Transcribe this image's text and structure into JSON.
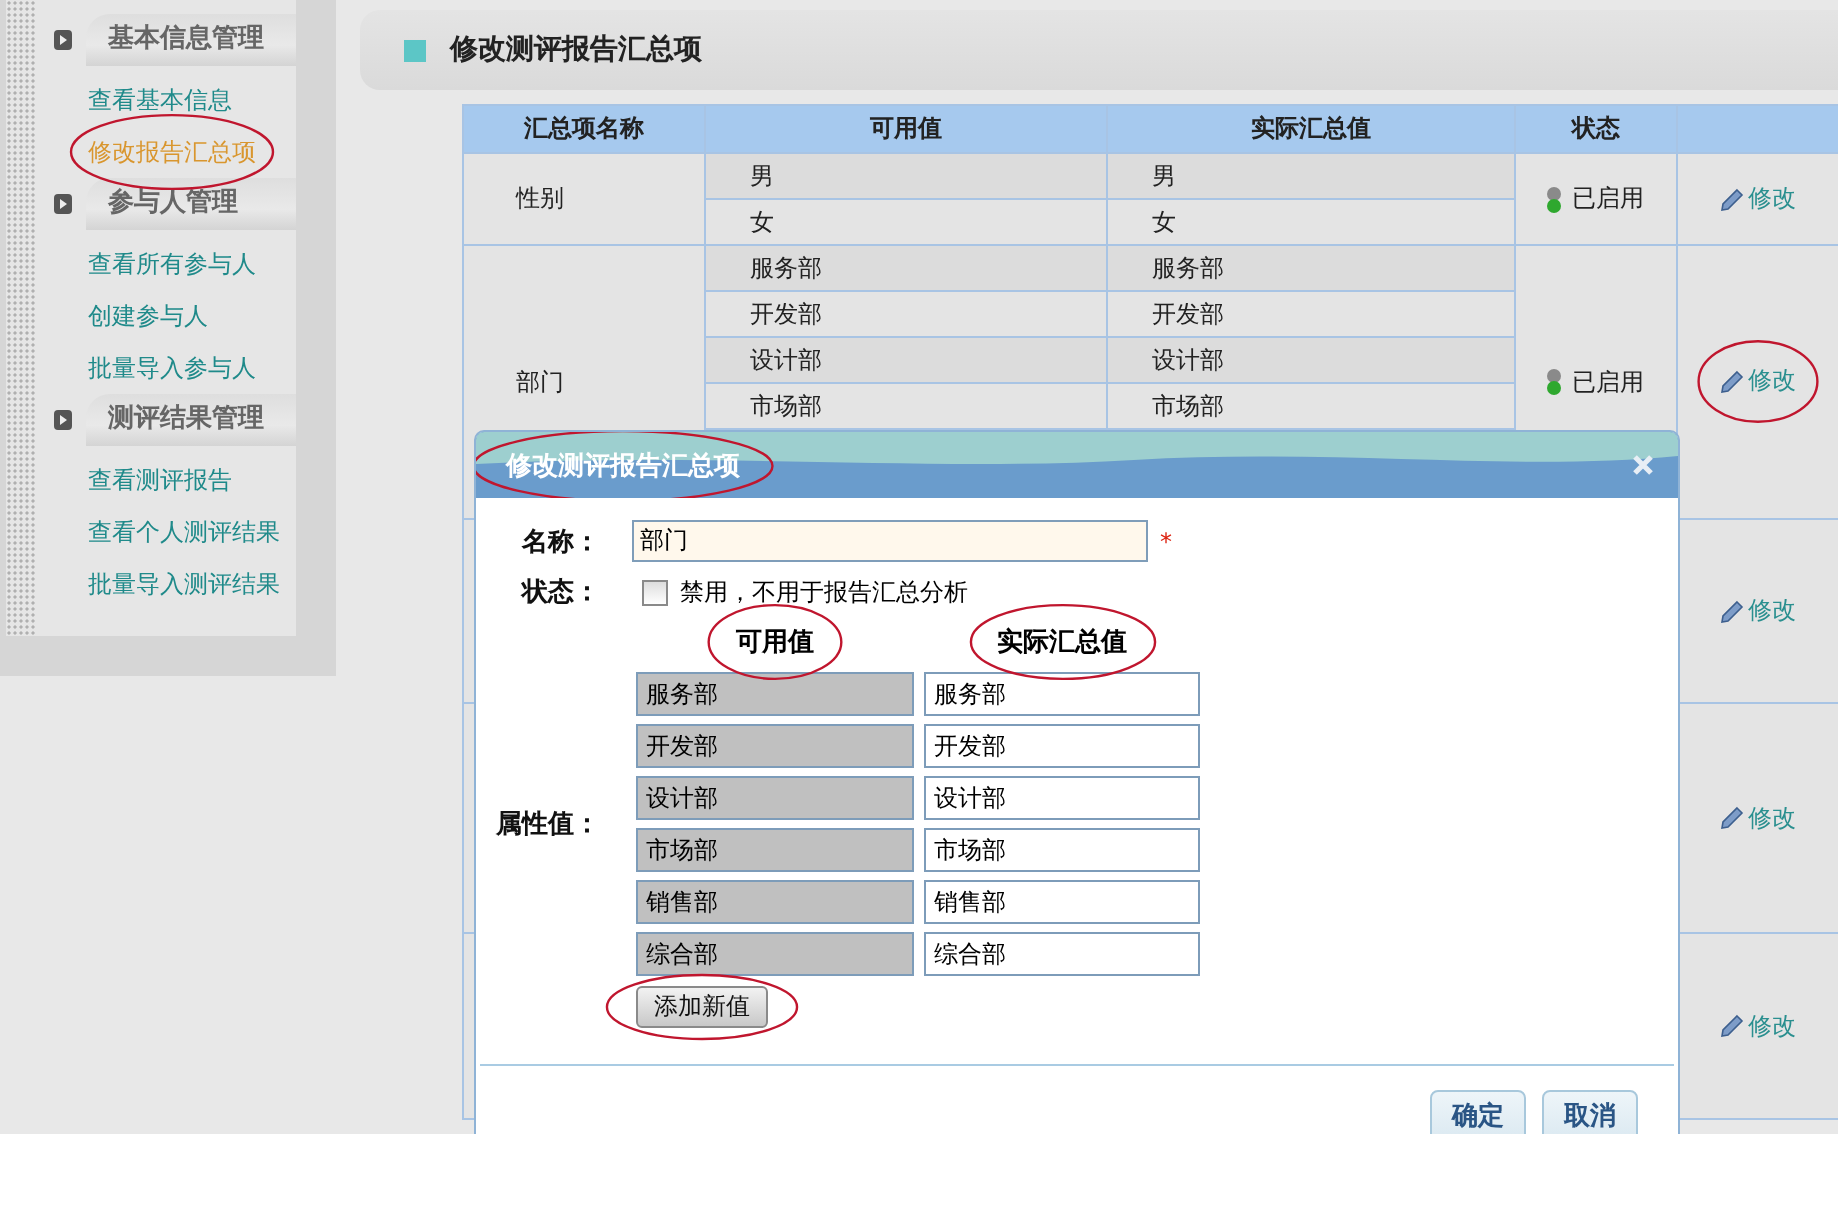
{
  "sidebar": {
    "sections": [
      {
        "title": "基本信息管理",
        "items": [
          {
            "label": "查看基本信息",
            "selected": false,
            "circled": false
          },
          {
            "label": "修改报告汇总项",
            "selected": true,
            "circled": true
          }
        ]
      },
      {
        "title": "参与人管理",
        "items": [
          {
            "label": "查看所有参与人",
            "selected": false,
            "circled": false
          },
          {
            "label": "创建参与人",
            "selected": false,
            "circled": false
          },
          {
            "label": "批量导入参与人",
            "selected": false,
            "circled": false
          }
        ]
      },
      {
        "title": "测评结果管理",
        "items": [
          {
            "label": "查看测评报告",
            "selected": false,
            "circled": false
          },
          {
            "label": "查看个人测评结果",
            "selected": false,
            "circled": false
          },
          {
            "label": "批量导入测评结果",
            "selected": false,
            "circled": false
          }
        ]
      }
    ]
  },
  "page_title": "修改测评报告汇总项",
  "table": {
    "columns": [
      "汇总项名称",
      "可用值",
      "实际汇总值",
      "状态"
    ],
    "rows": [
      {
        "name": "性别",
        "values": [
          {
            "available": "男",
            "actual": "男"
          },
          {
            "available": "女",
            "actual": "女"
          }
        ],
        "status": "已启用",
        "enabled": true,
        "action": "修改",
        "circled": false
      },
      {
        "name": "部门",
        "values": [
          {
            "available": "服务部",
            "actual": "服务部"
          },
          {
            "available": "开发部",
            "actual": "开发部"
          },
          {
            "available": "设计部",
            "actual": "设计部"
          },
          {
            "available": "市场部",
            "actual": "市场部"
          }
        ],
        "status": "已启用",
        "enabled": true,
        "action": "修改",
        "circled": true
      },
      {
        "action": "修改",
        "circled": false
      },
      {
        "action": "修改",
        "circled": false
      },
      {
        "action": "修改",
        "circled": false
      }
    ]
  },
  "dialog": {
    "title": "修改测评报告汇总项",
    "title_circled": true,
    "name_label": "名称：",
    "name_value": "部门",
    "required_mark": "*",
    "status_label": "状态：",
    "disable_checkbox": {
      "label": "禁用，不用于报告汇总分析",
      "checked": false
    },
    "columns": [
      {
        "label": "可用值",
        "circled": true
      },
      {
        "label": "实际汇总值",
        "circled": true
      }
    ],
    "values_label": "属性值：",
    "values": [
      {
        "available": "服务部",
        "actual": "服务部"
      },
      {
        "available": "开发部",
        "actual": "开发部"
      },
      {
        "available": "设计部",
        "actual": "设计部"
      },
      {
        "available": "市场部",
        "actual": "市场部"
      },
      {
        "available": "销售部",
        "actual": "销售部"
      },
      {
        "available": "综合部",
        "actual": "综合部"
      }
    ],
    "add_button": {
      "label": "添加新值",
      "circled": true
    },
    "buttons": [
      "确定",
      "取消"
    ]
  }
}
